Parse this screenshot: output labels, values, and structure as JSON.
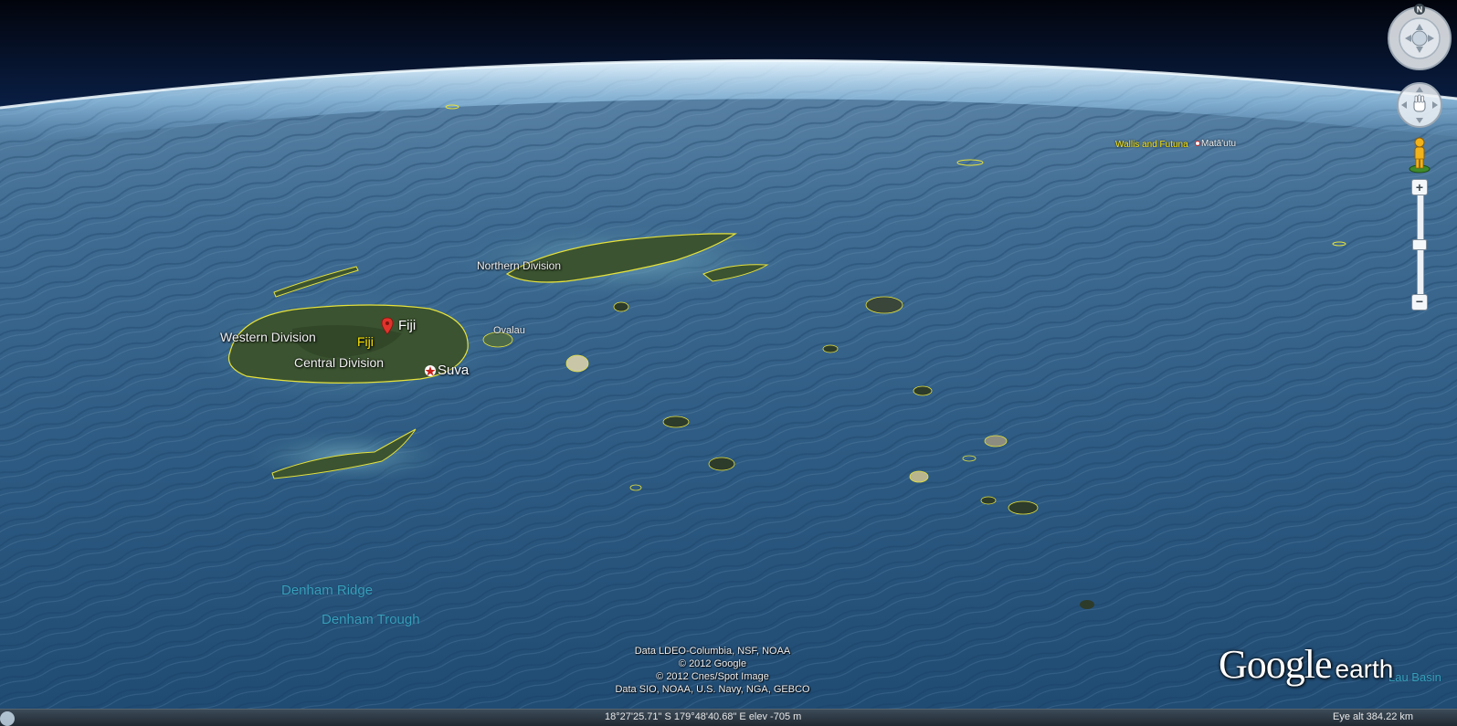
{
  "map": {
    "region_labels": {
      "western_division": "Western Division",
      "central_division": "Central Division",
      "northern_division": "Northern Division"
    },
    "place_labels": {
      "fiji_pin": "Fiji",
      "fiji_country": "Fiji",
      "suva": "Suva",
      "ovalau": "Ovalau",
      "wallis_futuna": "Wallis and Futuna",
      "mata_utu": "Matā'utu",
      "lau_basin": "Lau Basin"
    },
    "undersea_labels": {
      "denham_ridge": "Denham Ridge",
      "denham_trough": "Denham Trough"
    },
    "attribution": {
      "line1": "Data LDEO-Columbia, NSF, NOAA",
      "line2": "© 2012 Google",
      "line3": "© 2012 Cnes/Spot Image",
      "line4": "Data SIO, NOAA, U.S. Navy, NGA, GEBCO"
    }
  },
  "status_bar": {
    "coordinates": "18°27'25.71\" S 179°48'40.68\" E elev -705 m",
    "eye_alt": "Eye alt  384.22 km"
  },
  "controls": {
    "compass_north": "N",
    "zoom_in": "+",
    "zoom_out": "−"
  },
  "logo": {
    "google": "Google",
    "earth": "earth"
  },
  "colors": {
    "ocean": "#2f5b82",
    "ocean_dark": "#1e4266",
    "land": "#3c5534",
    "border": "#e6e23a",
    "atmosphere": "#bfe6ff",
    "space": "#040a1a"
  }
}
